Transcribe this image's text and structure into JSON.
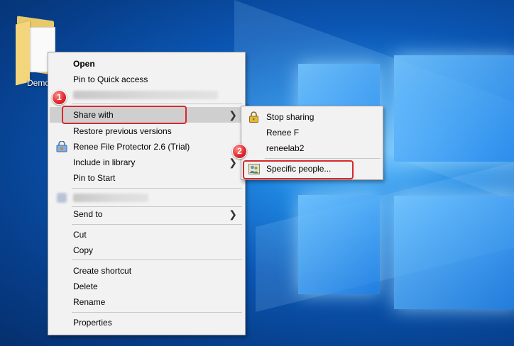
{
  "desktop": {
    "icon_label": "Demo"
  },
  "context_menu": {
    "open": "Open",
    "pin_quick_access": "Pin to Quick access",
    "share_with": "Share with",
    "restore_previous": "Restore previous versions",
    "renee_protector": "Renee File Protector 2.6 (Trial)",
    "include_in_library": "Include in library",
    "pin_to_start": "Pin to Start",
    "send_to": "Send to",
    "cut": "Cut",
    "copy": "Copy",
    "create_shortcut": "Create shortcut",
    "delete": "Delete",
    "rename": "Rename",
    "properties": "Properties",
    "submenu_arrow": "❯"
  },
  "share_submenu": {
    "stop_sharing": "Stop sharing",
    "renee_f": "Renee F",
    "reneelab2": "reneelab2",
    "specific_people": "Specific people..."
  },
  "annotations": {
    "step1": "1",
    "step2": "2",
    "color": "#d8282d"
  },
  "icons": {
    "lock": "lock-icon",
    "people": "people-icon",
    "protector": "renee-protector-icon",
    "chevron": "chevron-right-icon"
  }
}
